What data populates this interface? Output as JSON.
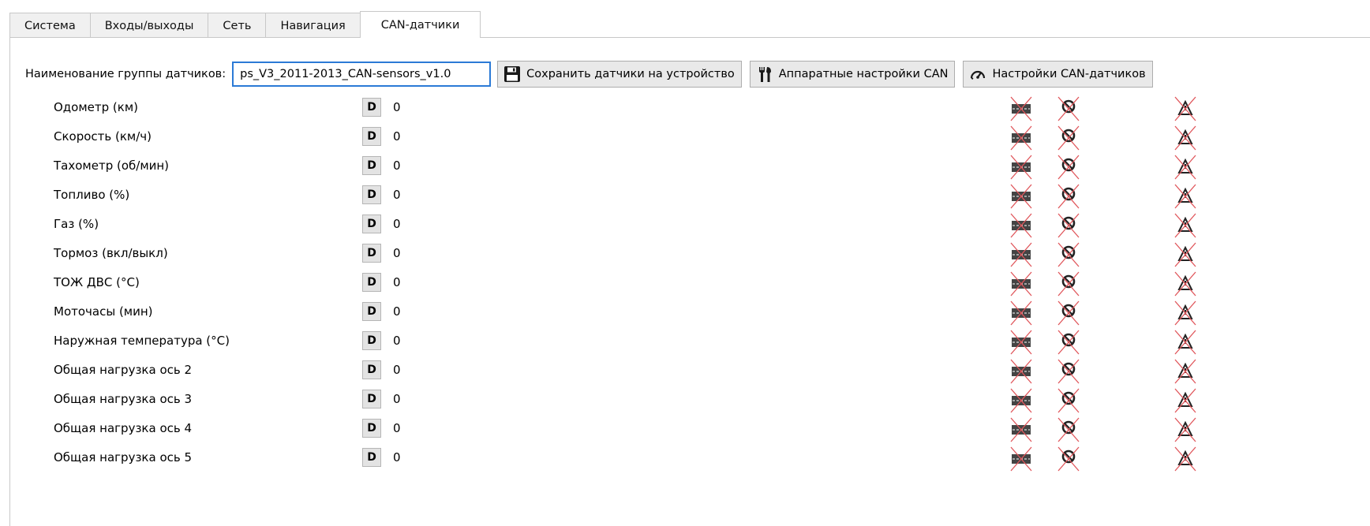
{
  "tabs": [
    "Система",
    "Входы/выходы",
    "Сеть",
    "Навигация",
    "CAN-датчики"
  ],
  "active_tab": "CAN-датчики",
  "toolbar": {
    "group_label": "Наименование группы датчиков:",
    "group_value": "ps_V3_2011-2013_CAN-sensors_v1.0",
    "save_label": "Сохранить датчики на устройство",
    "hw_label": "Аппаратные настройки CAN",
    "can_settings_label": "Настройки CAN-датчиков"
  },
  "sensors": [
    {
      "name": "Одометр (км)",
      "type": "D",
      "value": "0"
    },
    {
      "name": "Скорость (км/ч)",
      "type": "D",
      "value": "0"
    },
    {
      "name": "Тахометр (об/мин)",
      "type": "D",
      "value": "0"
    },
    {
      "name": "Топливо (%)",
      "type": "D",
      "value": "0"
    },
    {
      "name": "Газ (%)",
      "type": "D",
      "value": "0"
    },
    {
      "name": "Тормоз (вкл/выкл)",
      "type": "D",
      "value": "0"
    },
    {
      "name": "ТОЖ ДВС (°С)",
      "type": "D",
      "value": "0"
    },
    {
      "name": "Моточасы (мин)",
      "type": "D",
      "value": "0"
    },
    {
      "name": "Наружная температура (°С)",
      "type": "D",
      "value": "0"
    },
    {
      "name": "Общая нагрузка  ось 2",
      "type": "D",
      "value": "0"
    },
    {
      "name": "Общая нагрузка  ось 3",
      "type": "D",
      "value": "0"
    },
    {
      "name": "Общая нагрузка  ось 4",
      "type": "D",
      "value": "0"
    },
    {
      "name": "Общая нагрузка  ось 5",
      "type": "D",
      "value": "0"
    }
  ],
  "status_icons": [
    "road-disabled-icon",
    "speed-limit-disabled-icon",
    "warning-disabled-icon"
  ],
  "colors": {
    "accent": "#2b7ad6",
    "disabled_cross": "#e0555a"
  }
}
